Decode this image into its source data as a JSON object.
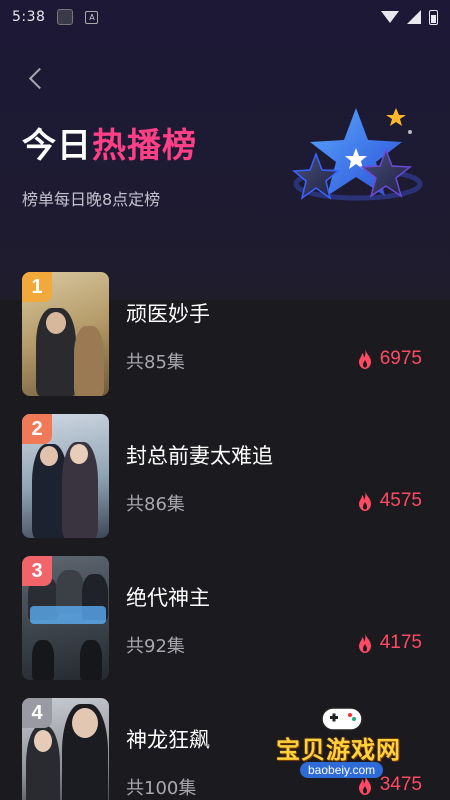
{
  "status_bar": {
    "time": "5:38"
  },
  "header": {
    "title_part1": "今日",
    "title_part2": "热播榜",
    "subtitle": "榜单每日晚8点定榜"
  },
  "ranking": [
    {
      "rank": "1",
      "title": "顽医妙手",
      "episodes": "共85集",
      "heat": "6975",
      "badge_color": "#f2a93b"
    },
    {
      "rank": "2",
      "title": "封总前妻太难追",
      "episodes": "共86集",
      "heat": "4575",
      "badge_color": "#f07a57"
    },
    {
      "rank": "3",
      "title": "绝代神主",
      "episodes": "共92集",
      "heat": "4175",
      "badge_color": "#f0646a"
    },
    {
      "rank": "4",
      "title": "神龙狂飙",
      "episodes": "共100集",
      "heat": "3475",
      "badge_color": "#9a9aa3"
    }
  ],
  "watermark": {
    "text": "宝贝游戏网",
    "url": "baobeiy.com"
  },
  "colors": {
    "accent": "#ff3f86",
    "heat": "#ff4a63"
  }
}
